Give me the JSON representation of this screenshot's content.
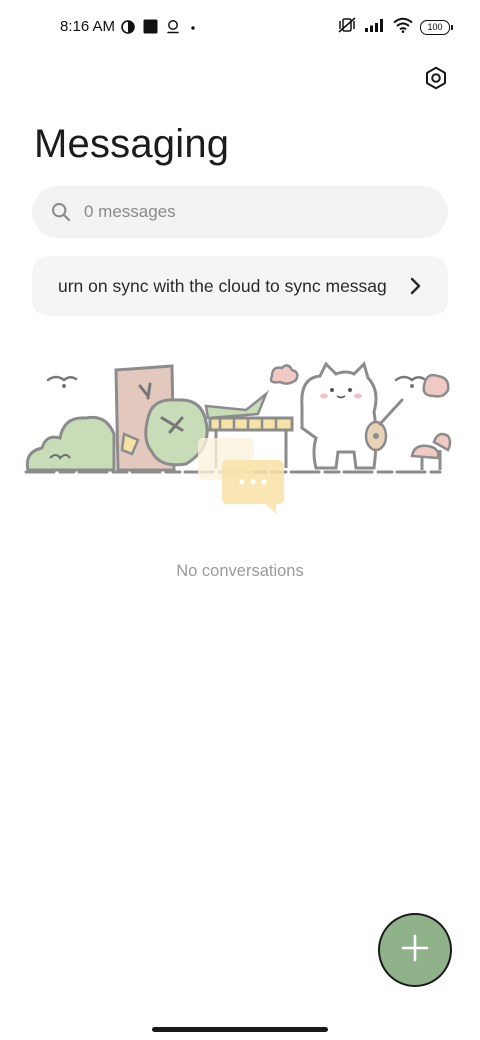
{
  "status_bar": {
    "time": "8:16 AM",
    "left_icons": [
      "data-saver-icon",
      "square-notification-icon",
      "location-icon",
      "dot-icon"
    ],
    "right_icons": [
      "muted-vibrate-icon",
      "cellular-signal-icon",
      "wifi-icon"
    ],
    "battery": "100"
  },
  "header": {
    "title": "Messaging",
    "settings_icon": "settings-hexagon-icon"
  },
  "search": {
    "placeholder": "0 messages",
    "icon": "search-icon"
  },
  "sync_banner": {
    "text": "urn on sync with the cloud to sync messag",
    "icon": "chevron-right-icon"
  },
  "empty_state": {
    "label": "No conversations"
  },
  "fab": {
    "icon": "plus-icon"
  },
  "colors": {
    "fab": "#8fb28a",
    "search_bg": "#f2f2f2",
    "banner_bg": "#f5f5f5",
    "muted_text": "#9a9a9a"
  }
}
